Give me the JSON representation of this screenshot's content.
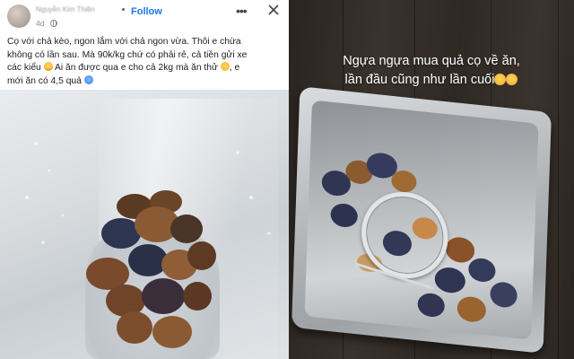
{
  "post": {
    "author_name": "Nguyễn Kim Thiện",
    "time": "4d",
    "follow_label": "Follow",
    "more_label": "•••",
    "text_lines": [
      "Cọ với chả kèo, ngon lắm với chả ngon vừa. Thôi e chừa",
      "không có lần sau. Mà 90k/kg chứ có phải rẻ, cả tiền gửi xe",
      "các kiểu",
      "Ai ăn được qua e cho cả 2kg mà ăn thử",
      ", e",
      "mới ăn có 4,5 quả"
    ],
    "photo_description_icon": "bag-photo-icon"
  },
  "story": {
    "caption_line1": "Ngựa ngựa mua quả cọ về ăn,",
    "caption_line2": "lần đầu cũng như lần cuối"
  },
  "colors": {
    "follow": "#1877f2",
    "text": "#1c1e21",
    "caption": "#ffffff"
  }
}
